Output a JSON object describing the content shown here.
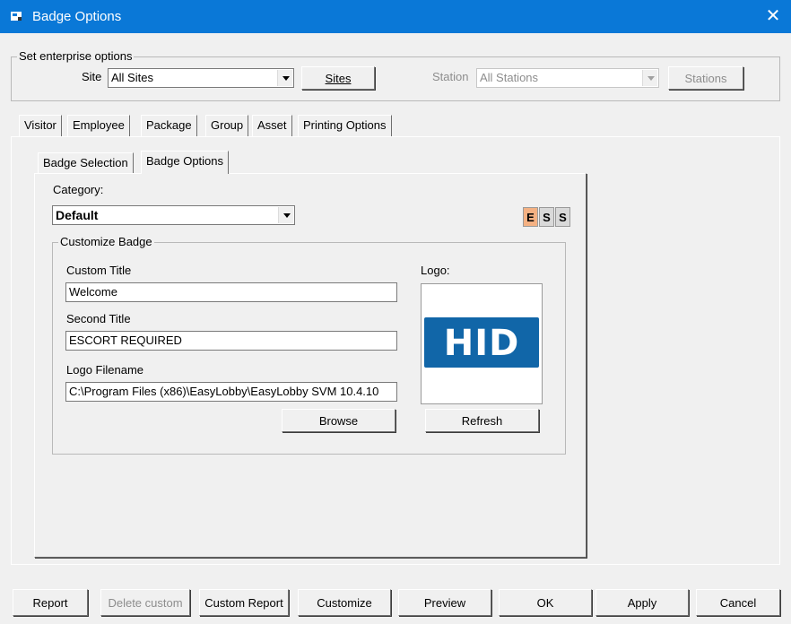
{
  "window": {
    "title": "Badge Options",
    "close_glyph": "✕"
  },
  "enterprise": {
    "legend": "Set enterprise options",
    "site_label": "Site",
    "site_value": "All Sites",
    "sites_button": "Sites",
    "station_label": "Station",
    "station_value": "All Stations",
    "stations_button": "Stations"
  },
  "tabs": [
    {
      "label": "Visitor"
    },
    {
      "label": "Employee"
    },
    {
      "label": "Package"
    },
    {
      "label": "Group"
    },
    {
      "label": "Asset"
    },
    {
      "label": "Printing Options"
    }
  ],
  "subtabs": [
    {
      "label": "Badge Selection"
    },
    {
      "label": "Badge Options"
    }
  ],
  "badge": {
    "category_label": "Category:",
    "category_value": "Default",
    "ess": [
      "E",
      "S",
      "S"
    ],
    "customize_legend": "Customize Badge",
    "custom_title_label": "Custom Title",
    "custom_title_value": "Welcome",
    "second_title_label": "Second Title",
    "second_title_value": "ESCORT REQUIRED",
    "logo_filename_label": "Logo Filename",
    "logo_filename_value": "C:\\Program Files (x86)\\EasyLobby\\EasyLobby SVM 10.4.10",
    "browse_button": "Browse",
    "logo_label": "Logo:",
    "logo_text": "HID",
    "refresh_button": "Refresh"
  },
  "footer": {
    "report": "Report",
    "delete_custom": "Delete custom",
    "custom_report": "Custom Report",
    "customize": "Customize",
    "preview": "Preview",
    "ok": "OK",
    "apply": "Apply",
    "cancel": "Cancel"
  },
  "colors": {
    "titlebar": "#0a78d7",
    "ess_e": "#f4b183",
    "ess_s": "#d9d9d9",
    "hid_blue": "#1166a8"
  }
}
